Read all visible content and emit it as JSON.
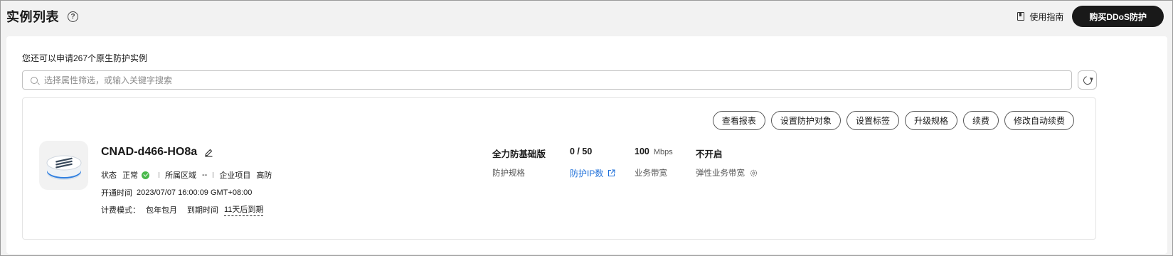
{
  "header": {
    "title": "实例列表",
    "help_glyph": "?",
    "guide_label": "使用指南",
    "buy_label": "购买DDoS防护"
  },
  "panel": {
    "quota_text": "您还可以申请267个原生防护实例",
    "search_placeholder": "选择属性筛选，或输入关键字搜索"
  },
  "instance": {
    "actions": [
      "查看报表",
      "设置防护对象",
      "设置标签",
      "升级规格",
      "续费",
      "修改自动续费"
    ],
    "name": "CNAD-d466-HO8a",
    "status_label": "状态",
    "status_value": "正常",
    "region_label": "所属区域",
    "region_value": "--",
    "project_label": "企业项目",
    "project_value": "高防",
    "open_time_label": "开通时间",
    "open_time_value": "2023/07/07 16:00:09 GMT+08:00",
    "billing_label": "计费模式：",
    "billing_value": "包年包月",
    "expire_label": "到期时间",
    "expire_value": "11天后到期",
    "spec_value": "全力防基础版",
    "spec_label": "防护规格",
    "ip_value": "0 / 50",
    "ip_label": "防护IP数",
    "bandwidth_value": "100",
    "bandwidth_unit": "Mbps",
    "bandwidth_label": "业务带宽",
    "elastic_value": "不开启",
    "elastic_label": "弹性业务带宽"
  },
  "colors": {
    "primary_button": "#191919",
    "link": "#1e6fd9",
    "status_ok": "#49b94b"
  }
}
